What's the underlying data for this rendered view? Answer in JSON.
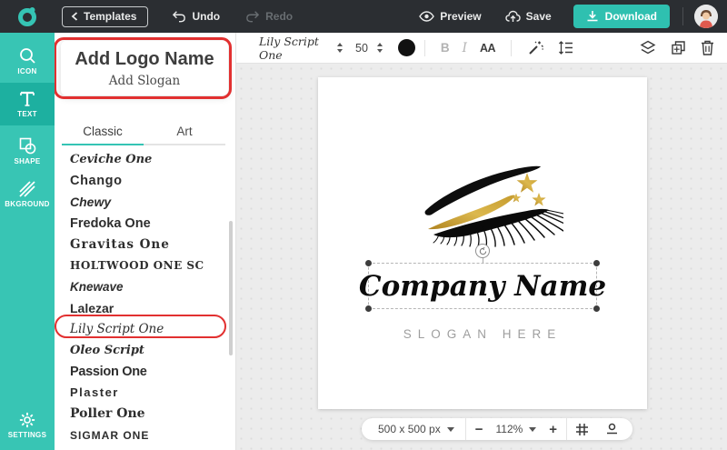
{
  "topbar": {
    "templates_label": "Templates",
    "undo_label": "Undo",
    "redo_label": "Redo",
    "preview_label": "Preview",
    "save_label": "Save",
    "download_label": "Download"
  },
  "sidebar": {
    "items": [
      {
        "label": "ICON"
      },
      {
        "label": "TEXT"
      },
      {
        "label": "SHAPE"
      },
      {
        "label": "BKGROUND"
      },
      {
        "label": "SETTINGS"
      }
    ]
  },
  "panel": {
    "logo_name_placeholder": "Add Logo Name",
    "slogan_placeholder": "Add Slogan",
    "tabs": [
      {
        "label": "Classic"
      },
      {
        "label": "Art"
      }
    ],
    "fonts": [
      "Ceviche One",
      "Chango",
      "Chewy",
      "Fredoka One",
      "Gravitas One",
      "HOLTWOOD ONE SC",
      "Knewave",
      "Lalezar",
      "Lily Script One",
      "Oleo Script",
      "Passion One",
      "Plaster",
      "Poller One",
      "Sigmar One"
    ]
  },
  "toolbar": {
    "font_name": "Lily Script One",
    "font_size": "50",
    "bold_label": "B",
    "italic_label": "I",
    "case_label": "AA"
  },
  "canvas": {
    "company_name": "Company Name",
    "slogan": "SLOGAN HERE"
  },
  "statusbar": {
    "size_label": "500 x 500 px",
    "zoom_label": "112%",
    "zoom_out_label": "−",
    "zoom_in_label": "+"
  },
  "colors": {
    "accent": "#35c4b4",
    "topbar_bg": "#2b2e32",
    "annotation_red": "#e23030",
    "gold": "#c59b2d",
    "text_swatch": "#111111"
  }
}
